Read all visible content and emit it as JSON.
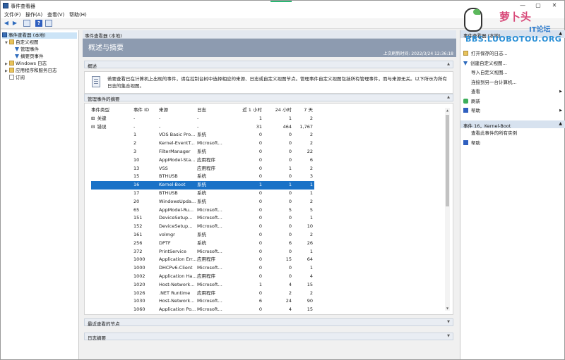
{
  "window": {
    "title": "事件查看器"
  },
  "menu": [
    "文件(F)",
    "操作(A)",
    "查看(V)",
    "帮助(H)"
  ],
  "tree": {
    "root": "事件查看器 (本地)",
    "custom_views": "自定义视图",
    "admin_events": "管理事件",
    "summary_events": "摘要页事件",
    "windows_logs": "Windows 日志",
    "app_service_logs": "应用程序和服务日志",
    "subscriptions": "订阅"
  },
  "center": {
    "header": "事件查看器 (本地)",
    "banner_title": "概述与摘要",
    "last_refresh": "上次刷新时间: 2022/3/24 12:36:18",
    "overview_label": "概述",
    "overview_text": "若要查看已在计算机上出现的事件，请在控制台树中选择相应的来源、日志或自定义视图节点。管理事件自定义视图包括所有管理事件，而与来源无关。以下所示为所有日志的集合视图。",
    "summary_label": "管理事件的摘要",
    "recent_nodes_label": "最近查看的节点",
    "log_summary_label": "日志摘要"
  },
  "table": {
    "headers": [
      "事件类型",
      "事件 ID",
      "来源",
      "日志",
      "近 1 小时",
      "24 小时",
      "7 天"
    ],
    "groups": [
      {
        "expand": "⊞",
        "type": "关键",
        "id": "-",
        "source": "-",
        "log": "-",
        "h1": "1",
        "h24": "1",
        "d7": "2"
      },
      {
        "expand": "⊟",
        "type": "错误",
        "id": "-",
        "source": "-",
        "log": "-",
        "h1": "31",
        "h24": "464",
        "d7": "1,767"
      }
    ],
    "rows": [
      [
        "1",
        "VDS Basic Pro...",
        "系统",
        "0",
        "0",
        "2"
      ],
      [
        "2",
        "Kernel-EventT...",
        "Microsoft...",
        "0",
        "0",
        "2"
      ],
      [
        "3",
        "FilterManager",
        "系统",
        "0",
        "0",
        "22"
      ],
      [
        "10",
        "AppModel-Sta...",
        "应用程序",
        "0",
        "0",
        "6"
      ],
      [
        "13",
        "VSS",
        "应用程序",
        "0",
        "1",
        "2"
      ],
      [
        "15",
        "BTHUSB",
        "系统",
        "0",
        "0",
        "3"
      ],
      [
        "16",
        "Kernel-Boot",
        "系统",
        "1",
        "1",
        "1"
      ],
      [
        "17",
        "BTHUSB",
        "系统",
        "0",
        "0",
        "1"
      ],
      [
        "20",
        "WindowsUpda...",
        "系统",
        "0",
        "0",
        "2"
      ],
      [
        "65",
        "AppModel-Ru...",
        "Microsoft...",
        "0",
        "5",
        "5"
      ],
      [
        "151",
        "DeviceSetup...",
        "Microsoft...",
        "0",
        "0",
        "1"
      ],
      [
        "152",
        "DeviceSetup...",
        "Microsoft...",
        "0",
        "0",
        "10"
      ],
      [
        "161",
        "volmgr",
        "系统",
        "0",
        "0",
        "2"
      ],
      [
        "256",
        "DPTF",
        "系统",
        "0",
        "6",
        "26"
      ],
      [
        "372",
        "PrintService",
        "Microsoft...",
        "0",
        "0",
        "1"
      ],
      [
        "1000",
        "Application Err...",
        "应用程序",
        "0",
        "15",
        "64"
      ],
      [
        "1000",
        "DHCPv6-Client",
        "Microsoft...",
        "0",
        "0",
        "1"
      ],
      [
        "1002",
        "Application Ha...",
        "应用程序",
        "0",
        "0",
        "4"
      ],
      [
        "1020",
        "Host-Network...",
        "Microsoft...",
        "1",
        "4",
        "15"
      ],
      [
        "1026",
        ".NET Runtime",
        "应用程序",
        "0",
        "2",
        "2"
      ],
      [
        "1030",
        "Host-Network...",
        "Microsoft...",
        "6",
        "24",
        "90"
      ],
      [
        "1060",
        "Application Po...",
        "Microsoft...",
        "0",
        "4",
        "15"
      ]
    ],
    "selected_index": 6
  },
  "actions": {
    "section1_header": "事件查看器 (本地)",
    "section1": [
      {
        "label": "打开保存的日志...",
        "icon": "folder-icon",
        "sub": false
      },
      {
        "label": "创建自定义视图...",
        "icon": "filter-icon",
        "sub": false
      },
      {
        "label": "导入自定义视图...",
        "icon": "none",
        "sub": false
      },
      {
        "label": "连接到另一台计算机...",
        "icon": "none",
        "sub": false
      },
      {
        "label": "查看",
        "icon": "none",
        "sub": true
      },
      {
        "label": "刷新",
        "icon": "refresh-icon",
        "sub": false
      },
      {
        "label": "帮助",
        "icon": "help-icon",
        "sub": true
      }
    ],
    "section2_header": "事件 16，Kernel-Boot",
    "section2": [
      {
        "label": "查看此事件的所有实例",
        "icon": "none",
        "sub": false
      },
      {
        "label": "帮助",
        "icon": "help-icon",
        "sub": false
      }
    ]
  },
  "watermark": {
    "name": "萝卜头",
    "it": "IT论坛",
    "url": "BBS.LUOBOTOU.ORG"
  },
  "colors": {
    "selection": "#1a72c7",
    "banner": "#8d9bb0",
    "tree_selection": "#cce4f7"
  }
}
